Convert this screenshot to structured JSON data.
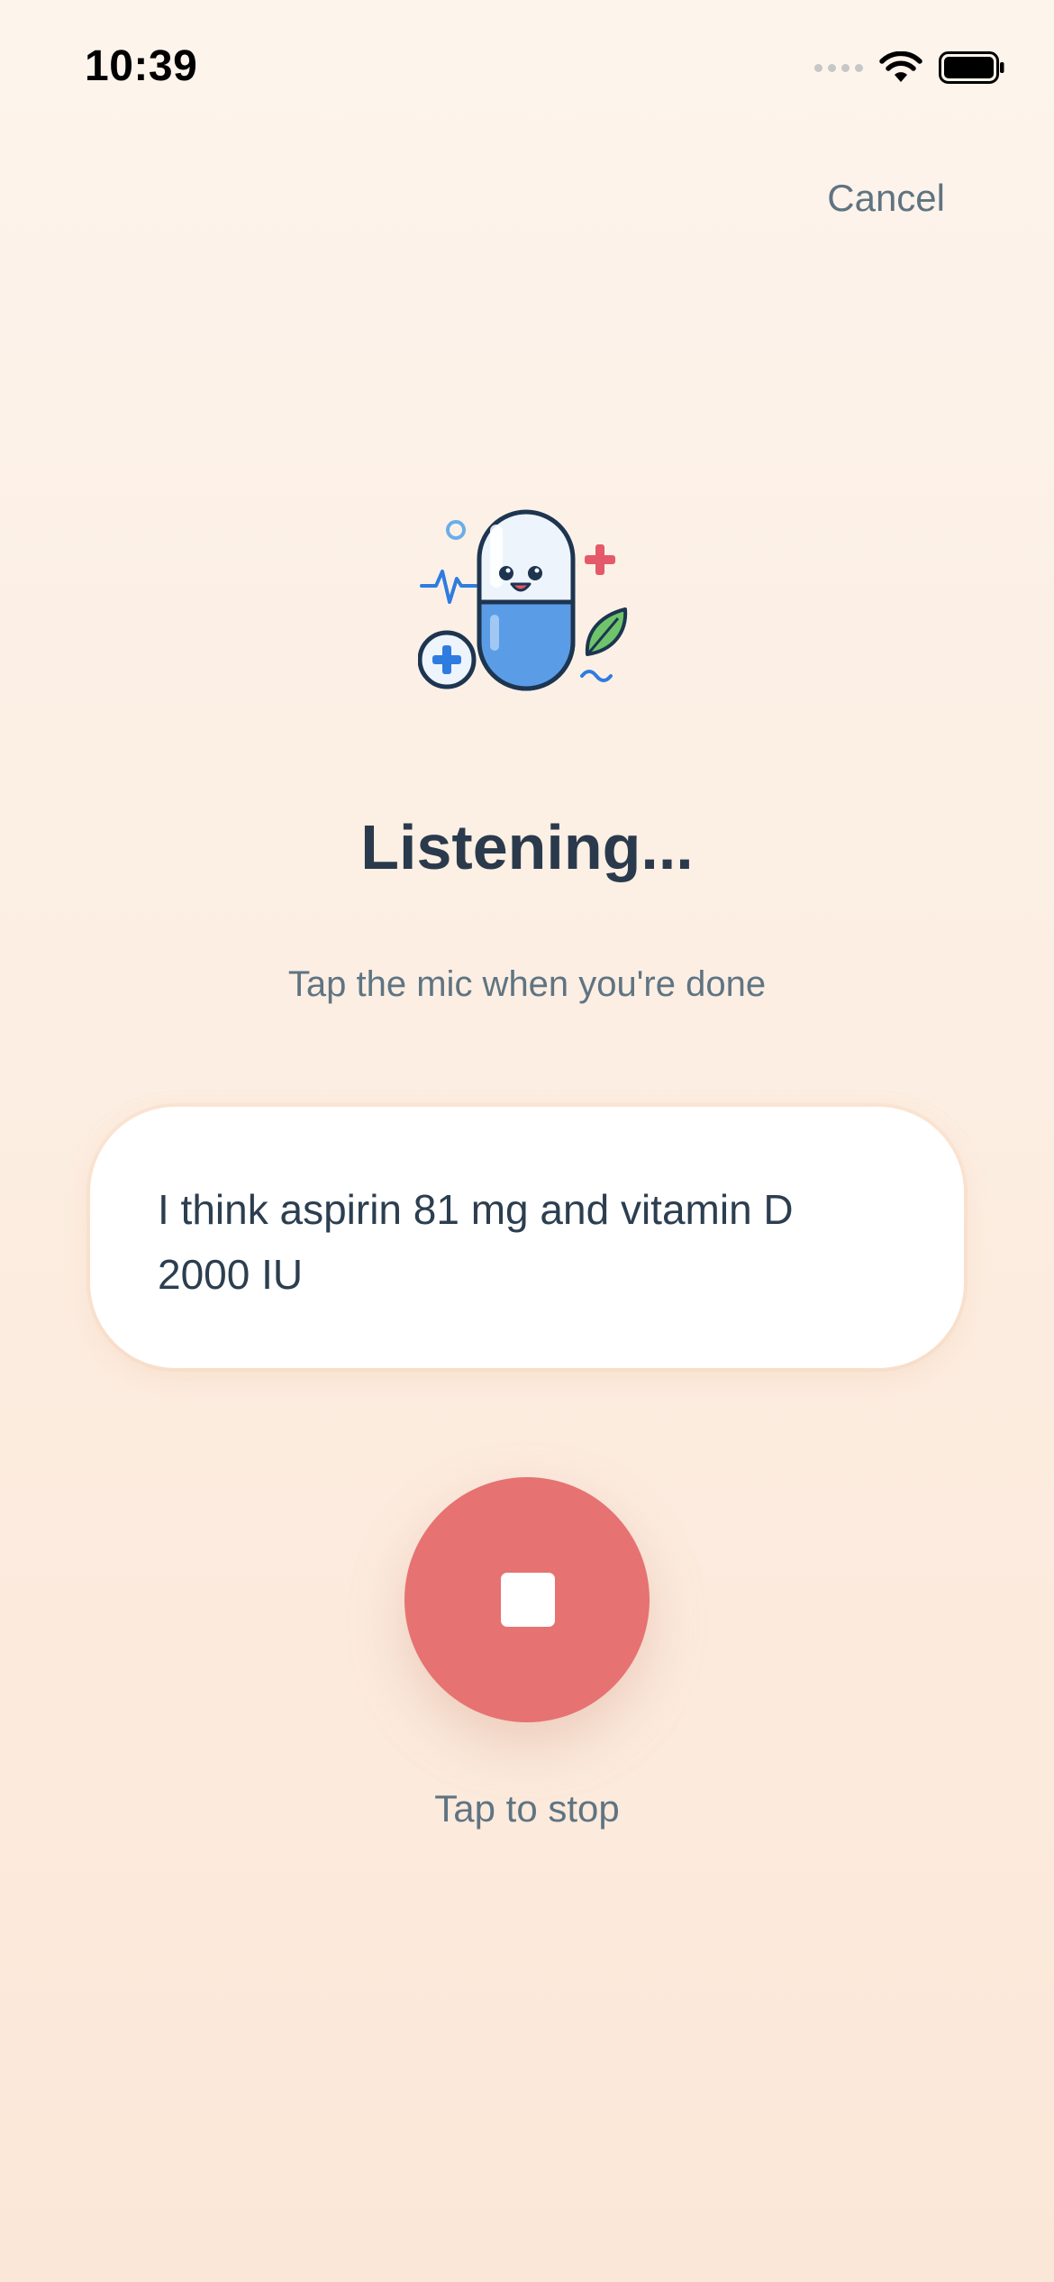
{
  "status_bar": {
    "time": "10:39",
    "icons": [
      "cellular-signal-icon",
      "wifi-icon",
      "battery-icon"
    ]
  },
  "header": {
    "cancel_label": "Cancel"
  },
  "illustration": {
    "icon": "pill-mascot-icon"
  },
  "main": {
    "title": "Listening...",
    "subtitle": "Tap the mic when you're done",
    "transcript": "I think aspirin 81 mg and vitamin D 2000 IU"
  },
  "controls": {
    "stop_icon": "stop-icon",
    "stop_label": "Tap to stop"
  },
  "colors": {
    "accent": "#e67272",
    "text_primary": "#2a3a4c",
    "text_secondary": "#5f7482",
    "background_top": "#fdf4ec",
    "background_bottom": "#fbe7d8"
  }
}
